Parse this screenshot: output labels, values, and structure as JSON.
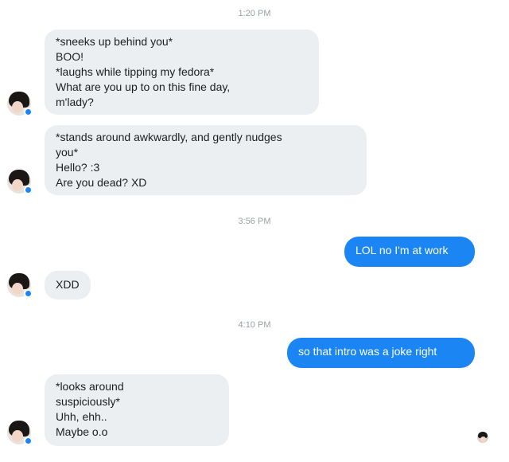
{
  "conversation": {
    "timestamps": [
      "1:20 PM",
      "3:56 PM",
      "4:10 PM"
    ],
    "messages": [
      {
        "sender": "them",
        "text": "*sneeks up behind you*\nBOO!\n*laughs while tipping my fedora*\nWhat are you up to on this fine day,\nm'lady?"
      },
      {
        "sender": "them",
        "text": "*stands around awkwardly, and gently nudges\nyou*\nHello? :3\nAre you dead? XD"
      },
      {
        "sender": "me",
        "text": "LOL no I'm at work"
      },
      {
        "sender": "them",
        "text": "XDD"
      },
      {
        "sender": "me",
        "text": "so that intro was a joke right"
      },
      {
        "sender": "them",
        "text": "*looks around\nsuspiciously*\nUhh, ehh..\nMaybe o.o"
      }
    ]
  },
  "colors": {
    "outgoing_bubble": "#1b86f3",
    "incoming_bubble": "#eceff1",
    "timestamp_text": "#9aa0a6"
  },
  "icons": {
    "contact_avatar": "user-avatar-icon",
    "messenger_badge": "messenger-badge-icon",
    "seen_indicator": "seen-avatar-icon"
  }
}
